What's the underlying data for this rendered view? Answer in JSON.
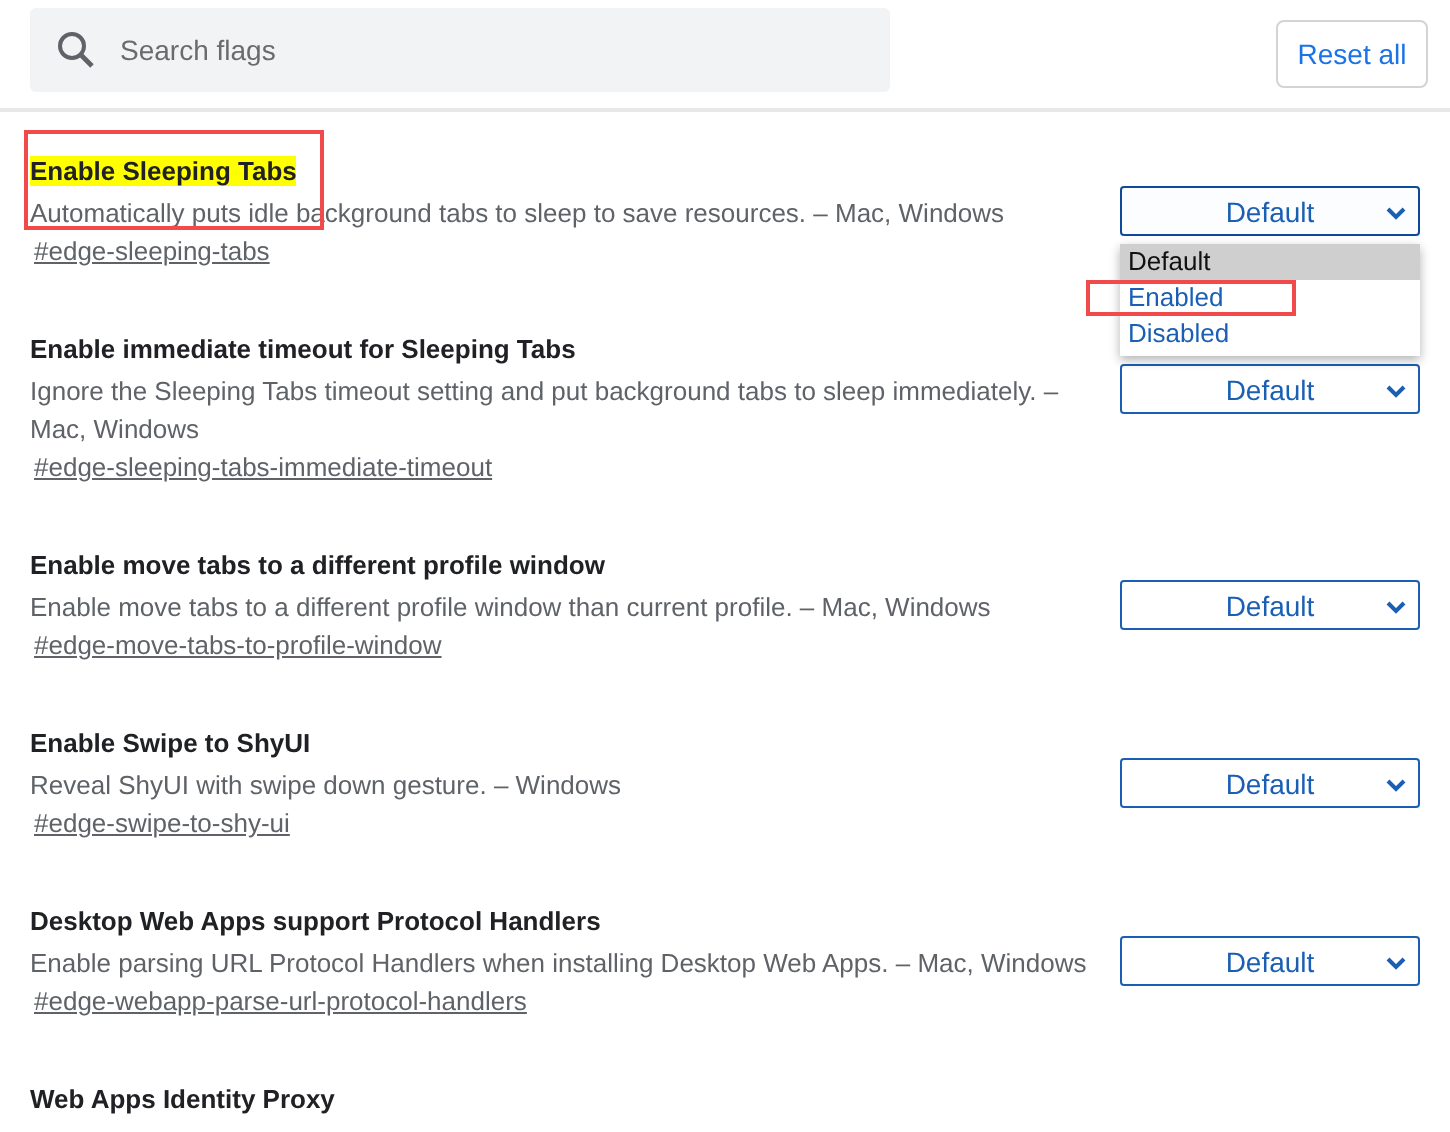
{
  "search": {
    "placeholder": "Search flags"
  },
  "reset_button": "Reset all",
  "flags": [
    {
      "title": "Enable Sleeping Tabs",
      "highlighted": true,
      "annotated": true,
      "description": "Automatically puts idle background tabs to sleep to save resources. – Mac, Windows",
      "link": "#edge-sleeping-tabs",
      "value": "Default",
      "expanded": true,
      "options": [
        {
          "label": "Default",
          "selected": true,
          "annotated": false
        },
        {
          "label": "Enabled",
          "selected": false,
          "annotated": true
        },
        {
          "label": "Disabled",
          "selected": false,
          "annotated": false
        }
      ]
    },
    {
      "title": "Enable immediate timeout for Sleeping Tabs",
      "highlighted": false,
      "annotated": false,
      "description": "Ignore the Sleeping Tabs timeout setting and put background tabs to sleep immediately. – Mac, Windows",
      "link": "#edge-sleeping-tabs-immediate-timeout",
      "value": "Default",
      "expanded": false
    },
    {
      "title": "Enable move tabs to a different profile window",
      "highlighted": false,
      "annotated": false,
      "description": "Enable move tabs to a different profile window than current profile. – Mac, Windows",
      "link": "#edge-move-tabs-to-profile-window",
      "value": "Default",
      "expanded": false
    },
    {
      "title": "Enable Swipe to ShyUI",
      "highlighted": false,
      "annotated": false,
      "description": "Reveal ShyUI with swipe down gesture. – Windows",
      "link": "#edge-swipe-to-shy-ui",
      "value": "Default",
      "expanded": false
    },
    {
      "title": "Desktop Web Apps support Protocol Handlers",
      "highlighted": false,
      "annotated": false,
      "description": "Enable parsing URL Protocol Handlers when installing Desktop Web Apps. – Mac, Windows",
      "link": "#edge-webapp-parse-url-protocol-handlers",
      "value": "Default",
      "expanded": false
    },
    {
      "title": "Web Apps Identity Proxy",
      "highlighted": false,
      "annotated": false
    }
  ]
}
